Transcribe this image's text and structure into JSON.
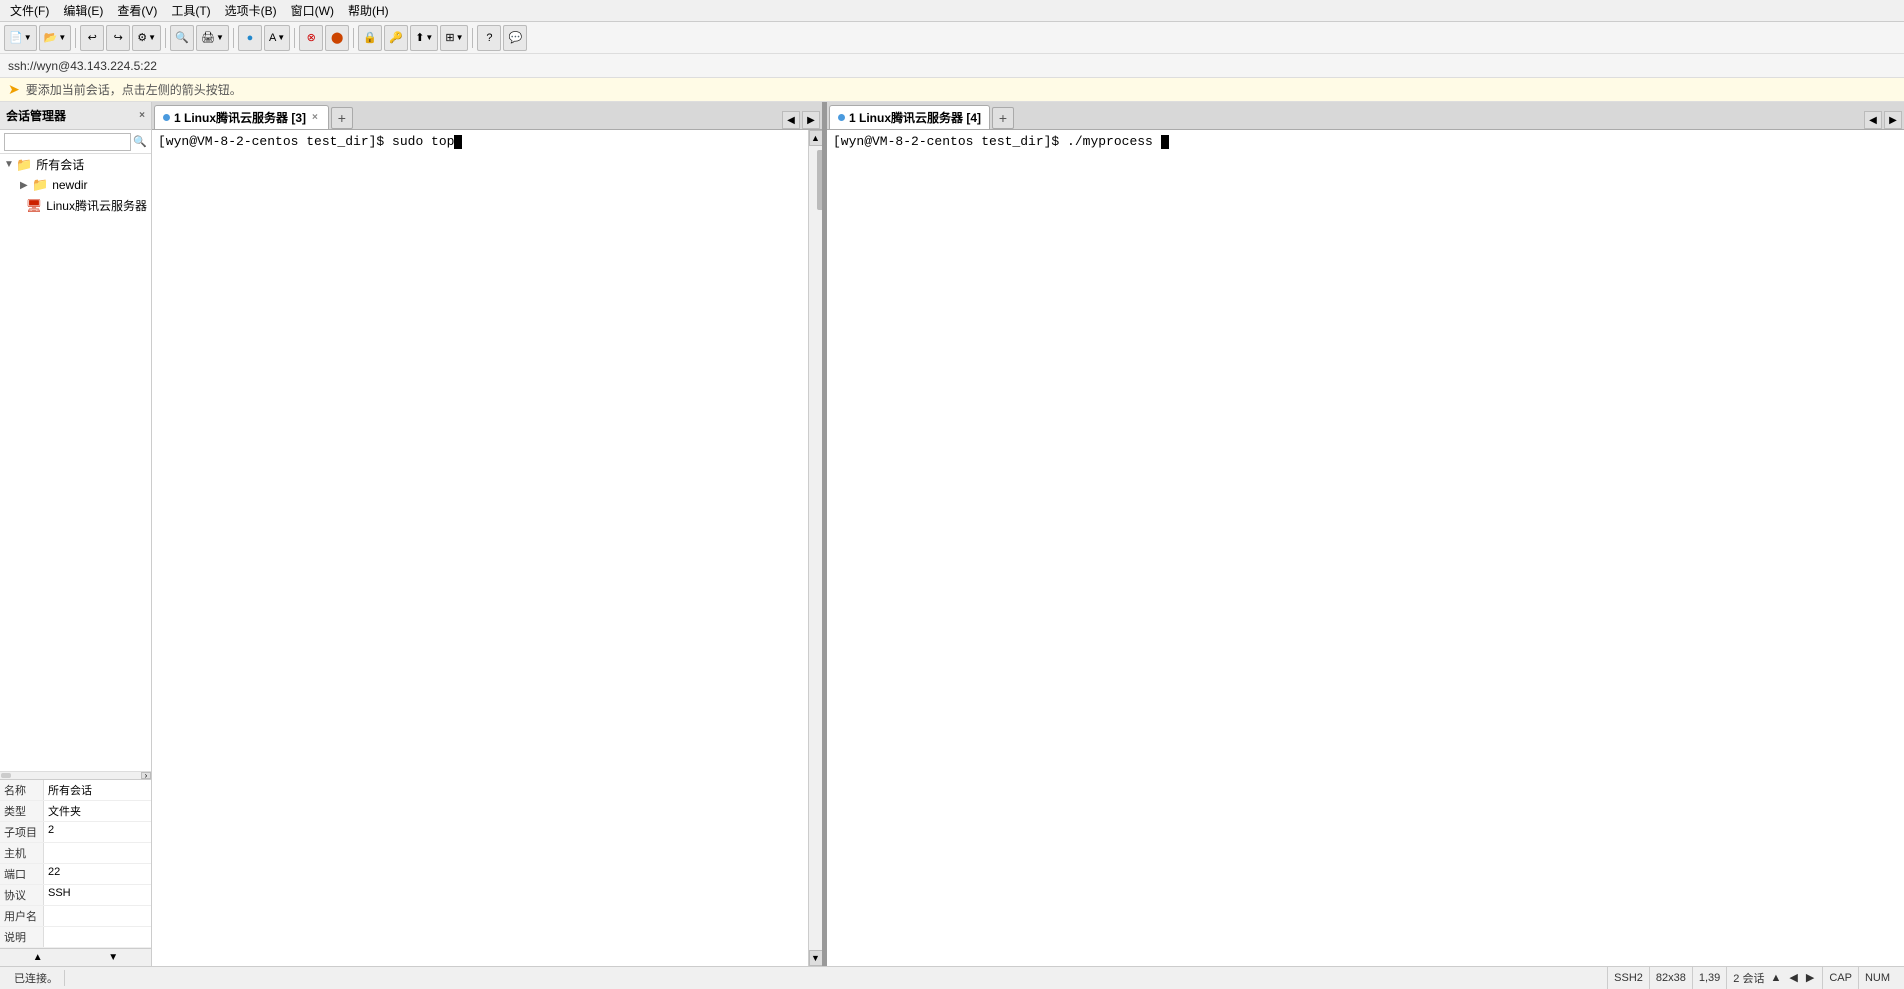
{
  "menubar": {
    "items": [
      "文件(F)",
      "编辑(E)",
      "查看(V)",
      "工具(T)",
      "选项卡(B)",
      "窗口(W)",
      "帮助(H)"
    ]
  },
  "addressbar": {
    "text": "ssh://wyn@43.143.224.5:22"
  },
  "hintbar": {
    "text": "要添加当前会话，点击左侧的箭头按钮。"
  },
  "sidebar": {
    "title": "会话管理器",
    "search_placeholder": "",
    "tree": [
      {
        "label": "所有会话",
        "type": "root",
        "indent": 0
      },
      {
        "label": "newdir",
        "type": "folder",
        "indent": 1
      },
      {
        "label": "Linux腾讯云服务器",
        "type": "server",
        "indent": 1
      }
    ],
    "properties": {
      "rows": [
        {
          "key": "名称",
          "val": "所有会话"
        },
        {
          "key": "类型",
          "val": "文件夹"
        },
        {
          "key": "子项目",
          "val": "2"
        },
        {
          "key": "主机",
          "val": ""
        },
        {
          "key": "端口",
          "val": "22"
        },
        {
          "key": "协议",
          "val": "SSH"
        },
        {
          "key": "用户名",
          "val": ""
        },
        {
          "key": "说明",
          "val": ""
        }
      ]
    }
  },
  "left_panel": {
    "tab_label": "1 Linux腾讯云服务器 [3]",
    "tab_dot": true,
    "command_line": "[wyn@VM-8-2-centos test_dir]$ sudo top"
  },
  "right_panel": {
    "tab_label": "1 Linux腾讯云服务器 [4]",
    "tab_dot": true,
    "command_line": "[wyn@VM-8-2-centos test_dir]$ ./myprocess "
  },
  "statusbar": {
    "status_text": "已连接。",
    "ssh2": "SSH2",
    "dimensions": "82x38",
    "cursor_pos": "1,39",
    "sessions": "2 会话",
    "cap": "CAP",
    "num": "NUM"
  }
}
